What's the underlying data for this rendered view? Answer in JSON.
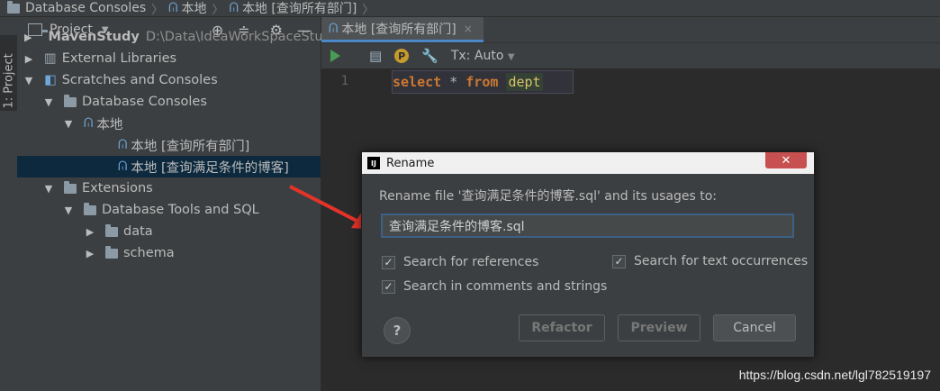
{
  "breadcrumb": {
    "items": [
      "Database Consoles",
      "本地",
      "本地 [查询所有部门]"
    ]
  },
  "side_stripe": {
    "tab_label": "1: Project"
  },
  "project_panel": {
    "title": "Project",
    "header_icons": [
      "target-icon",
      "collapse-icon",
      "gear-icon",
      "minimize-icon"
    ],
    "tree": [
      {
        "label": "MavenStudy",
        "path": "D:\\Data\\IdeaWorkSpaceStud",
        "bold": true,
        "arrow": "▶",
        "icon": "module-folder-icon"
      },
      {
        "label": "External Libraries",
        "arrow": "▶",
        "icon": "library-icon"
      },
      {
        "label": "Scratches and Consoles",
        "arrow": "▼",
        "icon": "scratches-icon"
      },
      {
        "label": "Database Consoles",
        "arrow": "▼",
        "icon": "folder-icon"
      },
      {
        "label": "本地",
        "arrow": "▼",
        "icon": "console-icon"
      },
      {
        "label": "本地 [查询所有部门]",
        "arrow": "",
        "icon": "console-icon"
      },
      {
        "label": "本地 [查询满足条件的博客]",
        "arrow": "",
        "icon": "console-icon",
        "selected": true
      },
      {
        "label": "Extensions",
        "arrow": "▼",
        "icon": "folder-icon"
      },
      {
        "label": "Database Tools and SQL",
        "arrow": "▼",
        "icon": "folder-icon"
      },
      {
        "label": "data",
        "arrow": "▶",
        "icon": "folder-icon"
      },
      {
        "label": "schema",
        "arrow": "▶",
        "icon": "folder-icon"
      }
    ]
  },
  "editor": {
    "tab_label": "本地 [查询所有部门]",
    "tab_close": "×",
    "tx_mode": "Tx: Auto",
    "line_number": "1",
    "code": {
      "kw1": "select",
      "op": "*",
      "kw2": "from",
      "table": "dept"
    }
  },
  "dialog": {
    "title": "Rename",
    "close": "✕",
    "message": "Rename file '查询满足条件的博客.sql' and its usages to:",
    "new_name": "查询满足条件的博客.sql",
    "options": {
      "search_references": {
        "label": "Search for references",
        "checked": true
      },
      "search_text": {
        "label": "Search for text occurrences",
        "checked": true
      },
      "search_comments": {
        "label": "Search in comments and strings",
        "checked": true
      }
    },
    "help": "?",
    "refactor": "Refactor",
    "preview": "Preview",
    "cancel": "Cancel"
  },
  "watermark": "https://blog.csdn.net/lgl782519197",
  "colors": {
    "accent": "#4a88c7",
    "selection": "#0d293e",
    "keyword": "#cc7832",
    "arrow": "#e5332a"
  }
}
